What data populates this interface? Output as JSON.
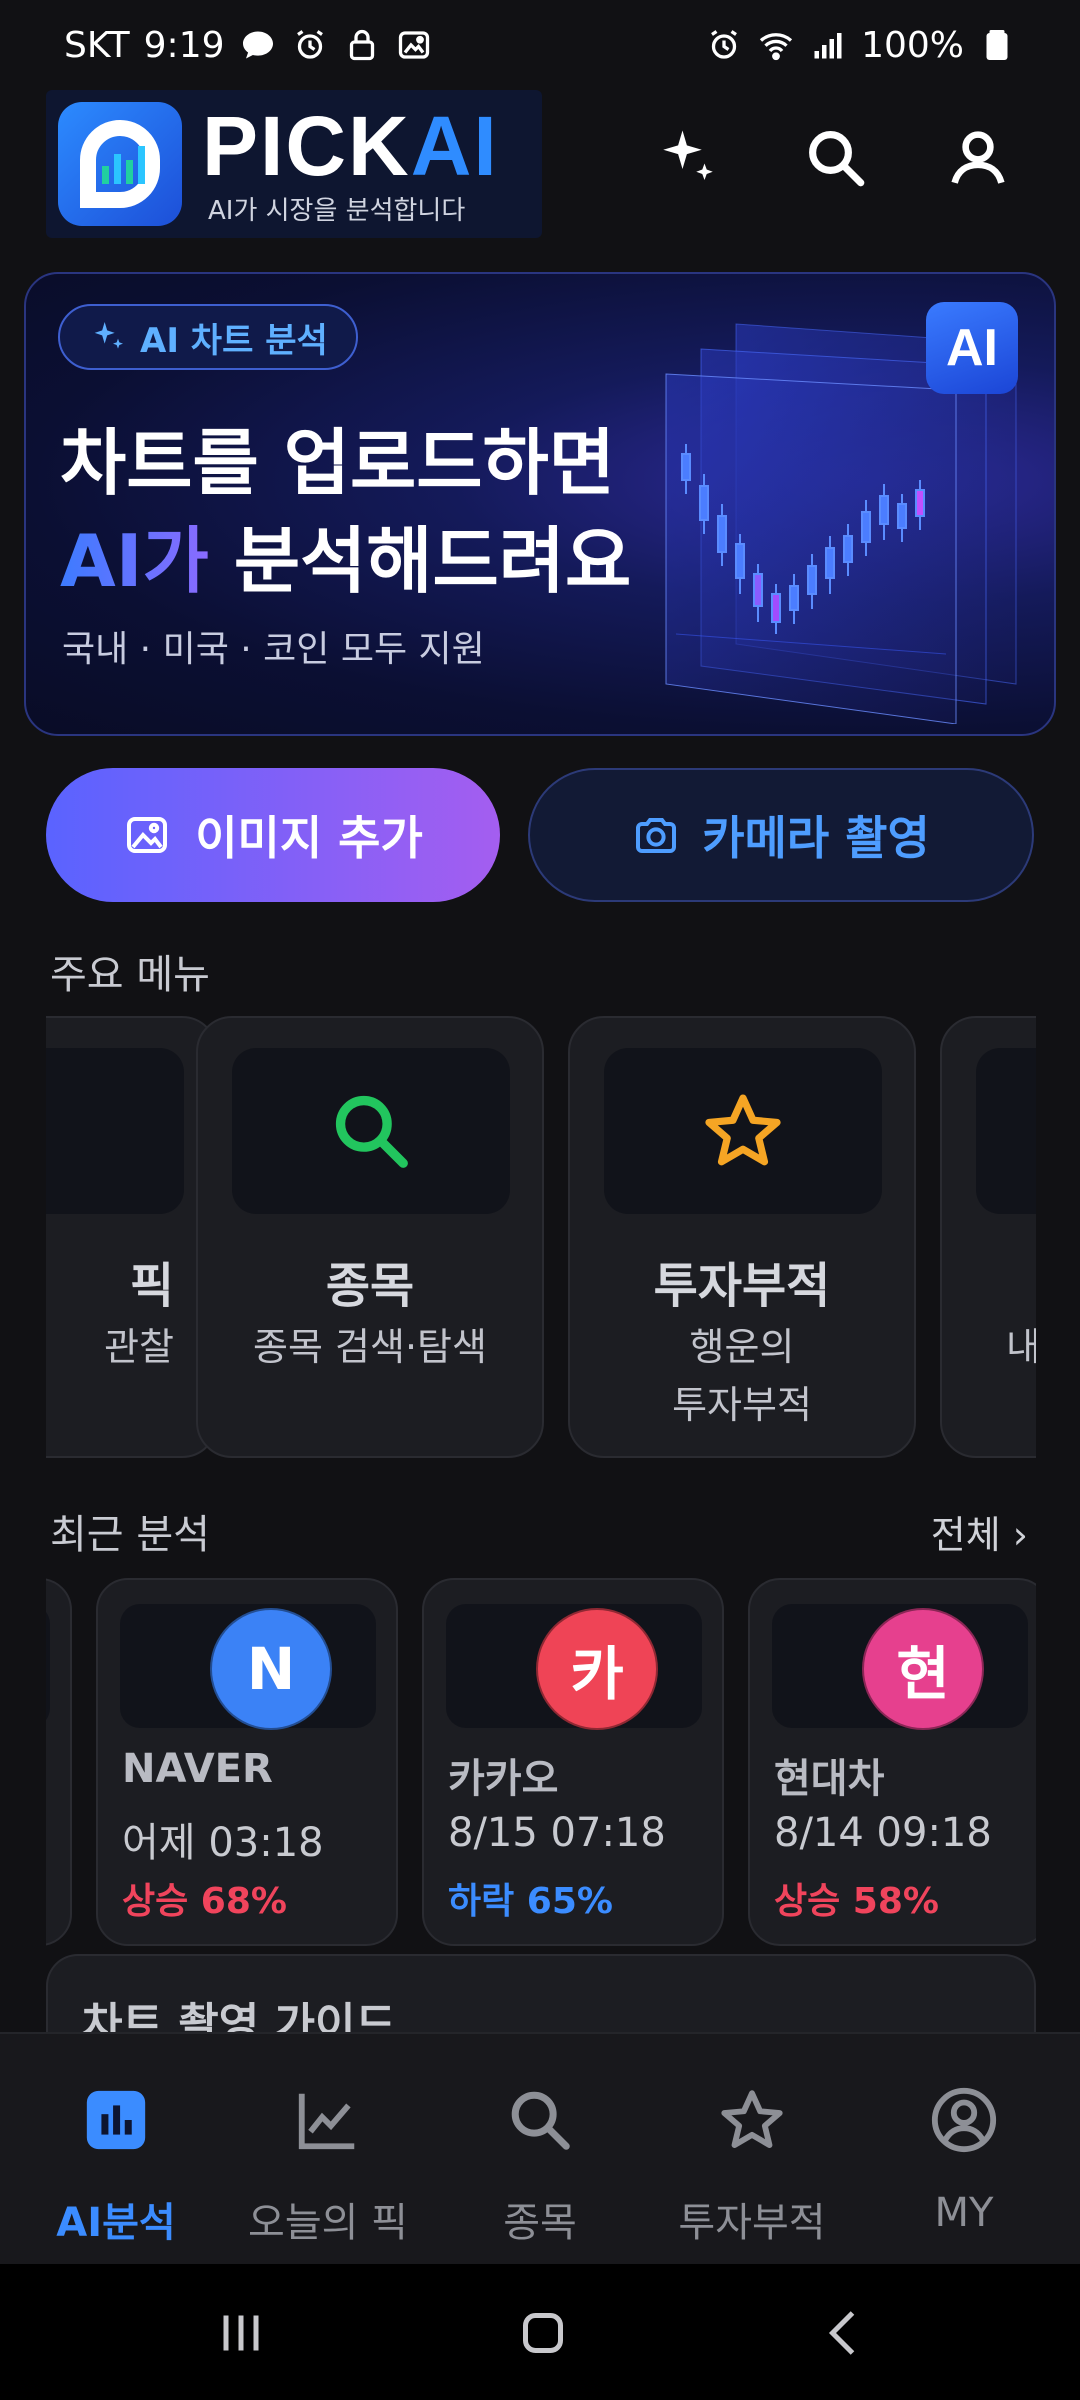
{
  "status_bar": {
    "carrier": "SKT",
    "time": "9:19",
    "battery": "100%"
  },
  "header": {
    "logo_word_1": "PICK",
    "logo_word_2": "AI",
    "logo_tagline": "AI가 시장을 분석합니다"
  },
  "banner": {
    "tag": "AI 차트 분석",
    "line1": "차트를 업로드하면",
    "line2_accent": "AI가",
    "line2_rest": " 분석해드려요",
    "subtitle": "국내 · 미국 · 코인 모두 지원",
    "ai_badge": "AI"
  },
  "actions": {
    "add_image": "이미지 추가",
    "camera": "카메라 촬영"
  },
  "main_menu": {
    "title": "주요 메뉴",
    "cards": [
      {
        "title": "픽",
        "desc_line1": "관찰",
        "desc_line2": ""
      },
      {
        "title": "종목",
        "desc_line1": "종목 검색·탐색",
        "desc_line2": "",
        "icon": "search-icon"
      },
      {
        "title": "투자부적",
        "desc_line1": "행운의",
        "desc_line2": "투자부적",
        "icon": "star-icon"
      },
      {
        "title": "",
        "desc_line1": "내",
        "desc_line2": ""
      }
    ]
  },
  "recent": {
    "title": "최근 분석",
    "see_all": "전체 ›",
    "items": [
      {
        "avatar": "N",
        "name": "NAVER",
        "time": "어제 03:18",
        "result": "상승 68%",
        "avatar_color": "#3b82f6",
        "result_color": "#f0445c"
      },
      {
        "avatar": "카",
        "name": "카카오",
        "time": "8/15 07:18",
        "result": "하락 65%",
        "avatar_color": "#ef4456",
        "result_color": "#3b8cff"
      },
      {
        "avatar": "현",
        "name": "현대차",
        "time": "8/14 09:18",
        "result": "상승 58%",
        "avatar_color": "#e6408e",
        "result_color": "#f0445c"
      }
    ]
  },
  "guide": {
    "title": "차트 촬영 가이드"
  },
  "bottom_nav": {
    "items": [
      {
        "label": "AI분석",
        "active": true
      },
      {
        "label": "오늘의 픽",
        "active": false
      },
      {
        "label": "종목",
        "active": false
      },
      {
        "label": "투자부적",
        "active": false
      },
      {
        "label": "MY",
        "active": false
      }
    ]
  },
  "colors": {
    "accent": "#3b8cff",
    "up": "#f0445c",
    "down": "#3b8cff",
    "background": "#111114"
  }
}
